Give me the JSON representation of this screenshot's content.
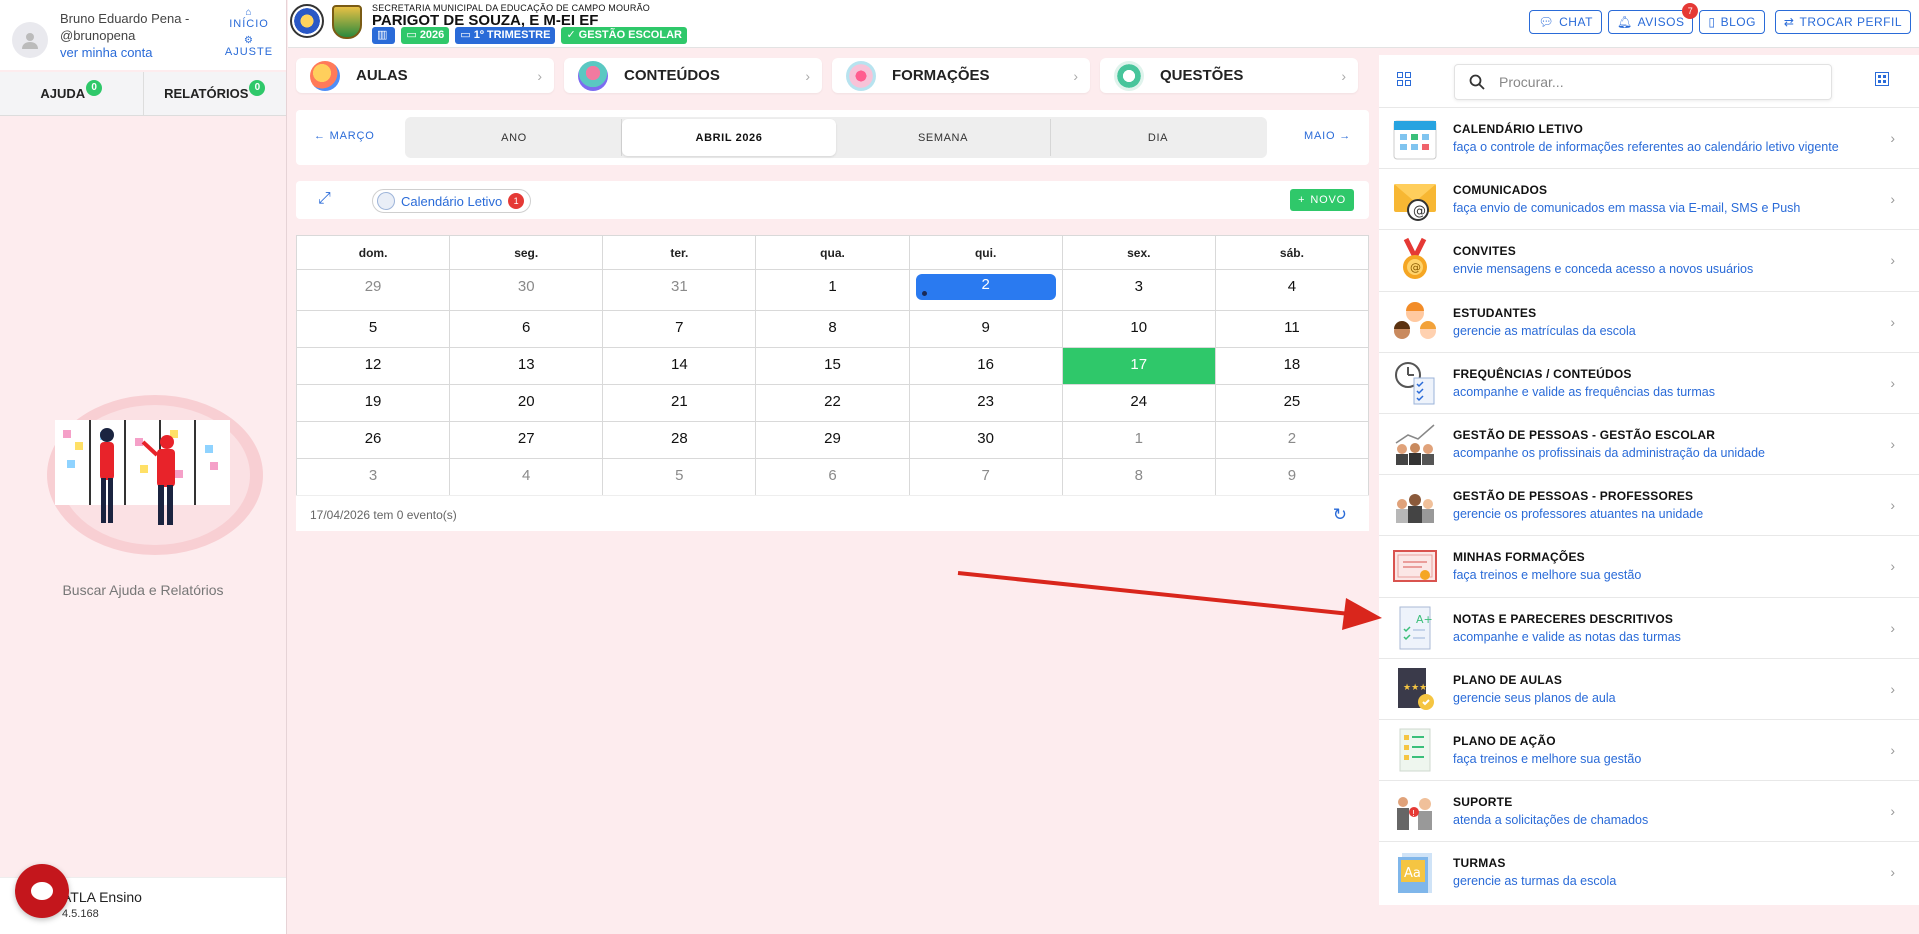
{
  "user": {
    "name_line1": "Bruno Eduardo Pena -",
    "name_line2": "@brunopena",
    "profile_link": "ver minha conta",
    "nav_home": "INÍCIO",
    "nav_settings": "AJUSTE"
  },
  "help_tabs": [
    {
      "label": "AJUDA",
      "count": "0"
    },
    {
      "label": "RELATÓRIOS",
      "count": "0"
    }
  ],
  "help_caption": "Buscar Ajuda e Relatórios",
  "app": {
    "name": "ATLA Ensino",
    "version": "4.5.168"
  },
  "header": {
    "secretaria": "SECRETARIA MUNICIPAL DA EDUCAÇÃO DE CAMPO MOURÃO",
    "school": "PARIGOT DE SOUZA, E M-EI EF",
    "chips": [
      {
        "label": "",
        "color": "blue",
        "icon": "building-icon"
      },
      {
        "label": "2026",
        "color": "green",
        "icon": "calendar-icon"
      },
      {
        "label": "1º TRIMESTRE",
        "color": "blue",
        "icon": "calendar-icon"
      },
      {
        "label": "GESTÃO ESCOLAR",
        "color": "green",
        "icon": "check-circle-icon"
      }
    ],
    "actions": {
      "chat": "CHAT",
      "avisos": "AVISOS",
      "avisos_count": "7",
      "blog": "BLOG",
      "trocar": "TROCAR PERFIL"
    }
  },
  "modules": [
    {
      "label": "AULAS",
      "icon": "aulas-icon"
    },
    {
      "label": "CONTEÚDOS",
      "icon": "conteudos-icon"
    },
    {
      "label": "FORMAÇÕES",
      "icon": "formacoes-icon"
    },
    {
      "label": "QUESTÕES",
      "icon": "questoes-icon"
    }
  ],
  "calendar_nav": {
    "prev": "MARÇO",
    "next": "MAIO",
    "views": [
      "ANO",
      "ABRIL 2026",
      "SEMANA",
      "DIA"
    ],
    "active_view": 1
  },
  "calendar_toolbar": {
    "chip_label": "Calendário Letivo",
    "chip_count": "1",
    "new_button": "NOVO"
  },
  "calendar": {
    "weekdays": [
      "dom.",
      "seg.",
      "ter.",
      "qua.",
      "qui.",
      "sex.",
      "sáb."
    ],
    "weeks": [
      [
        "29",
        "30",
        "31",
        "1",
        "2",
        "3",
        "4"
      ],
      [
        "5",
        "6",
        "7",
        "8",
        "9",
        "10",
        "11"
      ],
      [
        "12",
        "13",
        "14",
        "15",
        "16",
        "17",
        "18"
      ],
      [
        "19",
        "20",
        "21",
        "22",
        "23",
        "24",
        "25"
      ],
      [
        "26",
        "27",
        "28",
        "29",
        "30",
        "1",
        "2"
      ],
      [
        "3",
        "4",
        "5",
        "6",
        "7",
        "8",
        "9"
      ]
    ],
    "selected_day": "2",
    "today": "17",
    "footer_text": "17/04/2026 tem 0 evento(s)"
  },
  "search": {
    "placeholder": "Procurar..."
  },
  "shortcuts": [
    {
      "title": "CALENDÁRIO LETIVO",
      "subtitle": "faça o controle de informações referentes ao calendário letivo vigente",
      "icon": "calendar-icon"
    },
    {
      "title": "COMUNICADOS",
      "subtitle": "faça envio de comunicados em massa via E-mail, SMS e Push",
      "icon": "envelope-icon"
    },
    {
      "title": "CONVITES",
      "subtitle": "envie mensagens e conceda acesso a novos usuários",
      "icon": "medal-icon"
    },
    {
      "title": "ESTUDANTES",
      "subtitle": "gerencie as matrículas da escola",
      "icon": "students-icon"
    },
    {
      "title": "FREQUÊNCIAS / CONTEÚDOS",
      "subtitle": "acompanhe e valide as frequências das turmas",
      "icon": "clock-checklist-icon"
    },
    {
      "title": "GESTÃO DE PESSOAS - GESTÃO ESCOLAR",
      "subtitle": "acompanhe os profissinais da administração da unidade",
      "icon": "team-growth-icon"
    },
    {
      "title": "GESTÃO DE PESSOAS - PROFESSORES",
      "subtitle": "gerencie os professores atuantes na unidade",
      "icon": "teachers-icon"
    },
    {
      "title": "MINHAS FORMAÇÕES",
      "subtitle": "faça treinos e melhore sua gestão",
      "icon": "certificate-icon"
    },
    {
      "title": "NOTAS E PARECERES DESCRITIVOS",
      "subtitle": "acompanhe e valide as notas das turmas",
      "icon": "grade-sheet-icon"
    },
    {
      "title": "PLANO DE AULAS",
      "subtitle": "gerencie seus planos de aula",
      "icon": "lesson-book-icon"
    },
    {
      "title": "PLANO DE AÇÃO",
      "subtitle": "faça treinos e melhore sua gestão",
      "icon": "action-plan-icon"
    },
    {
      "title": "SUPORTE",
      "subtitle": "atenda a solicitações de chamados",
      "icon": "support-icon"
    },
    {
      "title": "TURMAS",
      "subtitle": "gerencie as turmas da escola",
      "icon": "classes-icon"
    }
  ],
  "colors": {
    "accent": "#2a6bd8",
    "success": "#2fc86a",
    "danger": "#e53935",
    "brand_red": "#c4161c",
    "annotation_arrow": "#d9261c"
  }
}
